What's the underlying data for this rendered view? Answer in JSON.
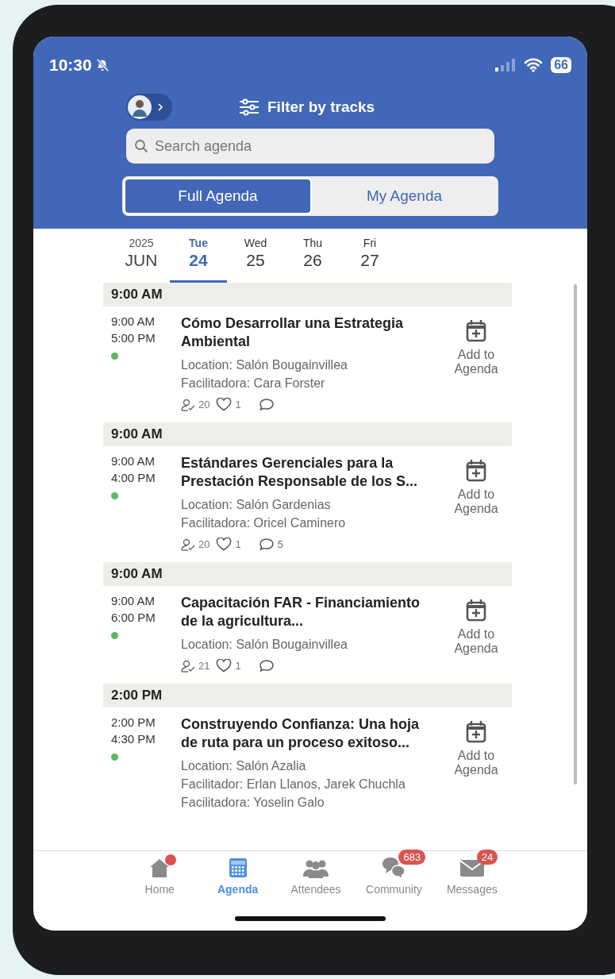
{
  "status_bar": {
    "time": "10:30",
    "battery": "66"
  },
  "header": {
    "filter_label": "Filter by tracks",
    "search": {
      "placeholder": "Search agenda"
    },
    "segments": [
      {
        "label": "Full Agenda",
        "selected": true
      },
      {
        "label": "My Agenda",
        "selected": false
      }
    ]
  },
  "date_strip": {
    "year": "2025",
    "month": "JUN",
    "days": [
      {
        "weekday": "Tue",
        "day": "24",
        "selected": true
      },
      {
        "weekday": "Wed",
        "day": "25",
        "selected": false
      },
      {
        "weekday": "Thu",
        "day": "26",
        "selected": false
      },
      {
        "weekday": "Fri",
        "day": "27",
        "selected": false
      }
    ]
  },
  "sessions": [
    {
      "group_time": "9:00 AM",
      "start": "9:00 AM",
      "end": "5:00 PM",
      "color": "#5cb85c",
      "title": "Cómo Desarrollar una Estrategia Ambiental",
      "details": [
        "Location: Salón Bougainvillea",
        "Facilitadora: Cara Forster"
      ],
      "attendees": "20",
      "likes": "1",
      "action": "Add to Agenda"
    },
    {
      "group_time": "9:00 AM",
      "start": "9:00 AM",
      "end": "4:00 PM",
      "color": "#5cb85c",
      "title": "Estándares Gerenciales para la Prestación Responsable de los S...",
      "details": [
        "Location: Salón Gardenias",
        "Facilitadora: Oricel Caminero"
      ],
      "attendees": "20",
      "likes": "1",
      "comments": "5",
      "action": "Add to Agenda"
    },
    {
      "group_time": "9:00 AM",
      "start": "9:00 AM",
      "end": "6:00 PM",
      "color": "#5cb85c",
      "title": "Capacitación FAR - Financiamiento de la agricultura...",
      "details": [
        "Location: Salón Bougainvillea"
      ],
      "attendees": "21",
      "likes": "1",
      "action": "Add to Agenda"
    },
    {
      "group_time": "2:00 PM",
      "start": "2:00 PM",
      "end": "4:30 PM",
      "color": "#5cb85c",
      "title": "Construyendo Confianza: Una hoja de ruta para un proceso exitoso...",
      "details": [
        "Location: Salón Azalia",
        "Facilitador: Erlan Llanos, Jarek Chuchla",
        "Facilitadora: Yoselin Galo"
      ],
      "action": "Add to Agenda"
    }
  ],
  "tab_bar": [
    {
      "kind": "home",
      "label": "Home",
      "selected": false,
      "dot": true
    },
    {
      "kind": "agenda",
      "label": "Agenda",
      "selected": true
    },
    {
      "kind": "attendees",
      "label": "Attendees",
      "selected": false
    },
    {
      "kind": "community",
      "label": "Community",
      "selected": false,
      "badge": "683"
    },
    {
      "kind": "messages",
      "label": "Messages",
      "selected": false,
      "badge": "24"
    }
  ]
}
